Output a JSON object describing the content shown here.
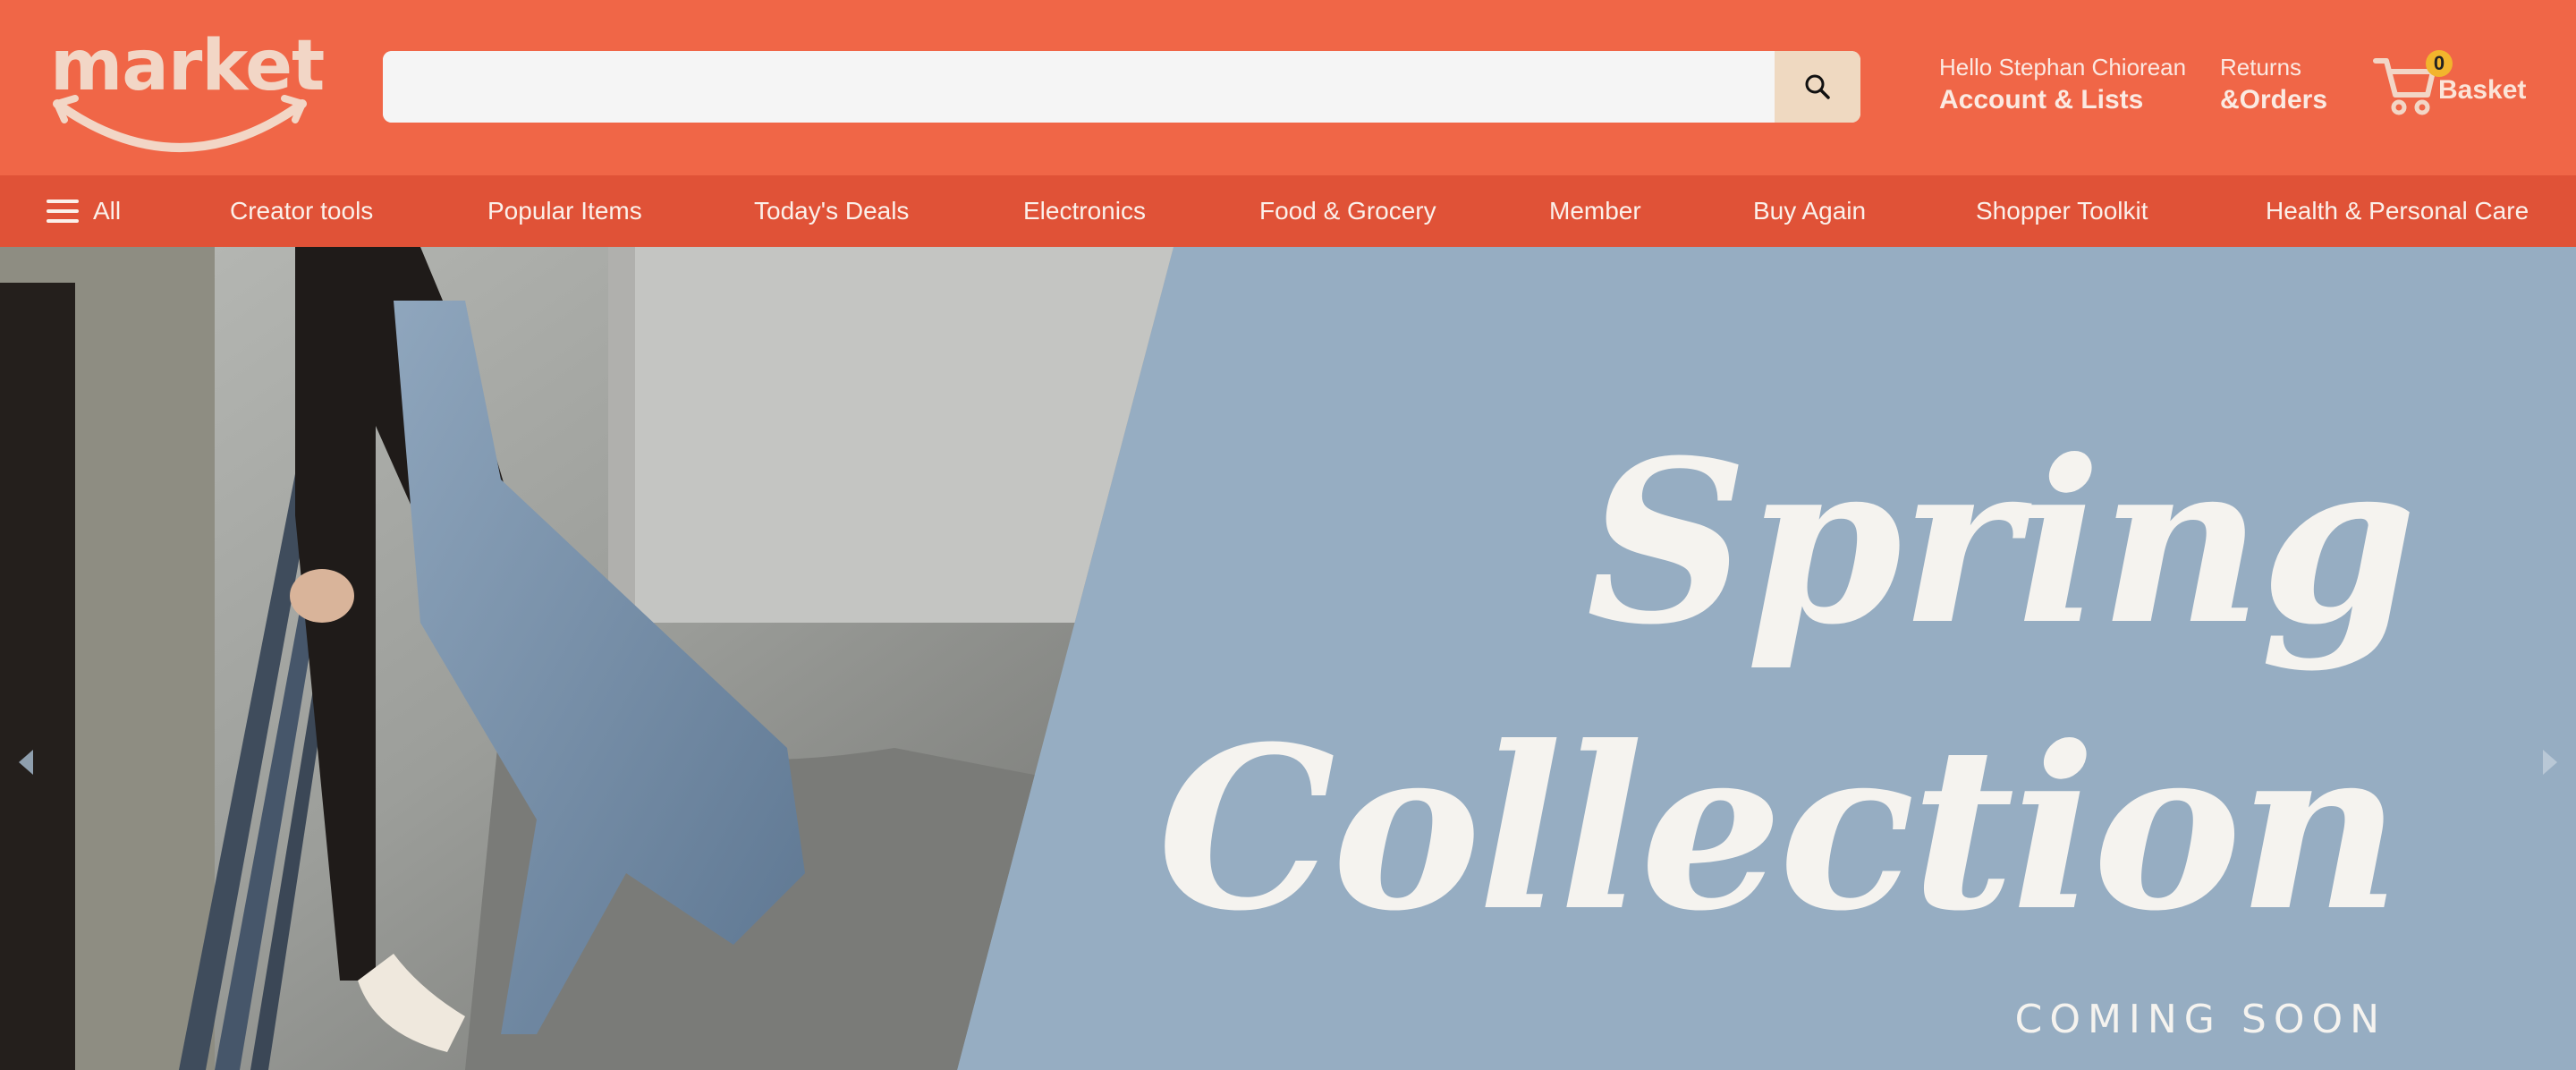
{
  "header": {
    "logo_text": "market",
    "search": {
      "value": "",
      "placeholder": ""
    },
    "greeting": "Hello Stephan Chiorean",
    "account_label": "Account & Lists",
    "returns_label": "Returns",
    "orders_label": "&Orders",
    "cart_count": "0",
    "basket_label": "Basket"
  },
  "nav": {
    "all_label": "All",
    "items": [
      {
        "label": "Creator tools"
      },
      {
        "label": "Popular Items"
      },
      {
        "label": "Today's Deals"
      },
      {
        "label": "Electronics"
      },
      {
        "label": "Food & Grocery"
      },
      {
        "label": "Member"
      },
      {
        "label": "Buy Again"
      },
      {
        "label": "Shopper Toolkit"
      },
      {
        "label": "Health & Personal Care"
      }
    ]
  },
  "hero": {
    "title_line1": "Spring",
    "title_line2": "Collection",
    "subtitle": "COMING SOON"
  },
  "colors": {
    "header_bg": "#f06647",
    "nav_bg": "#e05237",
    "hero_bg": "#96adc2",
    "search_button_bg": "#efd9c1",
    "cart_badge": "#f2b52d"
  },
  "icons": [
    "search-icon",
    "menu-icon",
    "cart-icon",
    "arrow-left-icon",
    "arrow-right-icon"
  ]
}
